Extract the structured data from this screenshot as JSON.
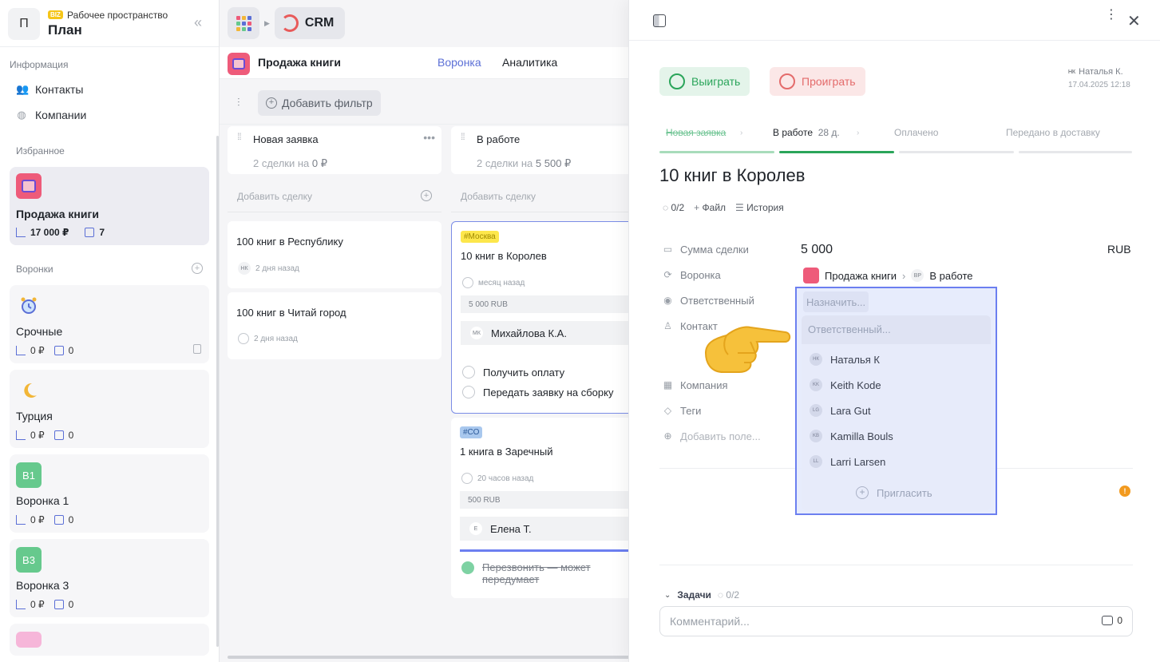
{
  "workspace": {
    "avatar": "П",
    "badge": "BIZ",
    "subtitle": "Рабочее пространство",
    "title": "План"
  },
  "sidebar": {
    "info_label": "Информация",
    "contacts": "Контакты",
    "companies": "Компании",
    "favorites_label": "Избранное",
    "favorite": {
      "name": "Продажа книги",
      "amount": "17 000 ₽",
      "count": "7"
    },
    "funnels_label": "Воронки",
    "funnels": [
      {
        "icon": "alarm-clock-icon",
        "name": "Срочные",
        "amount": "0 ₽",
        "count": "0",
        "locked": true
      },
      {
        "icon": "crescent-moon-icon",
        "name": "Турция",
        "amount": "0 ₽",
        "count": "0"
      },
      {
        "badge": "В1",
        "color": "#66c98d",
        "name": "Воронка 1",
        "amount": "0 ₽",
        "count": "0"
      },
      {
        "badge": "В3",
        "color": "#66c98d",
        "name": "Воронка 3",
        "amount": "0 ₽",
        "count": "0"
      }
    ]
  },
  "topbar": {
    "app": "CRM"
  },
  "board": {
    "title": "Продажа книги",
    "tabs": [
      "Воронка",
      "Аналитика"
    ],
    "add_filter": "Добавить фильтр",
    "add_deal": "Добавить сделку",
    "columns": [
      {
        "title": "Новая заявка",
        "summary_prefix": "2 сделки на",
        "summary_amount": "0 ₽",
        "deals": [
          {
            "name": "100 книг в Республику",
            "avatar": "НК",
            "time": "2 дня назад"
          },
          {
            "name": "100 книг в Читай город",
            "time": "2 дня назад"
          }
        ]
      },
      {
        "title": "В работе",
        "summary_prefix": "2 сделки на",
        "summary_amount": "5 500 ₽",
        "deals": [
          {
            "tag": "#Москва",
            "tag_color": "#fde74c",
            "name": "10 книг в Королев",
            "time": "месяц назад",
            "amount": "5 000 RUB",
            "resp_avatar": "МК",
            "resp": "Михайлова К.А.",
            "tasks": [
              "Получить оплату",
              "Передать заявку на сборку"
            ]
          },
          {
            "tag": "#СО",
            "tag_color": "#a9c8ee",
            "name": "1 книга в Заречный",
            "time": "20 часов назад",
            "amount": "500 RUB",
            "resp_avatar": "Е",
            "resp": "Елена Т.",
            "done_task": "Перезвонить — может передумает"
          }
        ]
      }
    ]
  },
  "panel": {
    "win": "Выиграть",
    "lose": "Проиграть",
    "author_avatar": "НК",
    "author": "Наталья К.",
    "date": "17.04.2025 12:18",
    "stages": [
      {
        "label": "Новая заявка",
        "state": "done"
      },
      {
        "label": "В работе",
        "days": "28 д.",
        "state": "current"
      },
      {
        "label": "Оплачено",
        "state": "todo"
      },
      {
        "label": "Передано в доставку",
        "state": "todo"
      }
    ],
    "title": "10 книг в Королев",
    "checklist": "0/2",
    "file": "Файл",
    "history": "История",
    "fields": {
      "amount_label": "Сумма сделки",
      "amount": "5 000",
      "currency": "RUB",
      "funnel_label": "Воронка",
      "funnel": "Продажа книги",
      "stage_avatar": "ВР",
      "stage": "В работе",
      "responsible_label": "Ответственный",
      "contact_label": "Контакт",
      "company_label": "Компания",
      "tags_label": "Теги",
      "add_field": "Добавить поле..."
    },
    "tasks_label": "Задачи",
    "tasks_count": "0/2",
    "comment_placeholder": "Комментарий...",
    "comment_count": "0"
  },
  "dropdown": {
    "assign": "Назначить...",
    "search_placeholder": "Ответственный...",
    "people": [
      {
        "avatar": "НК",
        "name": "Наталья К"
      },
      {
        "avatar": "KK",
        "name": "Keith Kode"
      },
      {
        "avatar": "LG",
        "name": "Lara Gut"
      },
      {
        "avatar": "KB",
        "name": "Kamilla Bouls"
      },
      {
        "avatar": "LL",
        "name": "Larri Larsen"
      }
    ],
    "invite": "Пригласить"
  },
  "colors": {
    "accent": "#5b6fd6",
    "win": "#2aa55a",
    "lose": "#e46b6b",
    "selection": "#6c7ff0"
  }
}
